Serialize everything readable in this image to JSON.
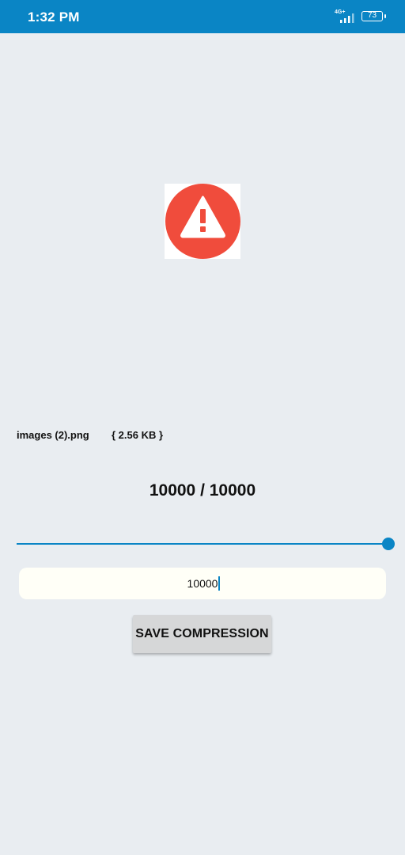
{
  "status_bar": {
    "time": "1:32 PM",
    "network": "4G+",
    "battery": "73",
    "color": "#0a85c5"
  },
  "main": {
    "warning_icon": "warning-icon",
    "file_name": "images (2).png",
    "file_size": "{ 2.56 KB }",
    "quality_readout": "10000 / 10000",
    "slider": {
      "value": 10000,
      "max": 10000
    },
    "input_value": "10000",
    "save_button": "SAVE COMPRESSION"
  },
  "colors": {
    "accent": "#0a85c5",
    "warning": "#f04c3c",
    "background": "#e9edf1"
  }
}
